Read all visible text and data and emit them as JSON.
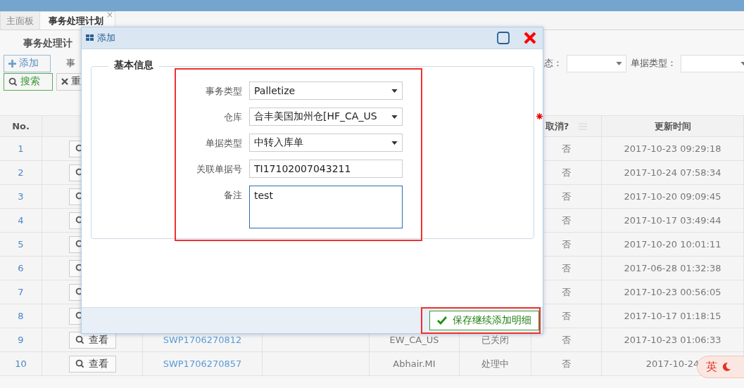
{
  "tabs": [
    {
      "label": "主面板",
      "selected": false
    },
    {
      "label": "事务处理计划",
      "selected": true,
      "close": "×"
    }
  ],
  "search_panel": {
    "title": "事务处理计",
    "add_button": "添加",
    "cut_label": "事",
    "search_button": "搜索",
    "reset_button": "重",
    "filters": [
      {
        "label": "态："
      },
      {
        "label": "单据类型："
      }
    ]
  },
  "table": {
    "header": {
      "no": "No.",
      "cancelled": "取消?",
      "updated": "更新时间"
    },
    "rows": [
      {
        "no": "1",
        "actions": [
          {
            "kind": "view"
          }
        ],
        "cancelled": "否",
        "updated": "2017-10-23 09:29:18"
      },
      {
        "no": "2",
        "actions": [
          {
            "kind": "view"
          }
        ],
        "cancelled": "否",
        "updated": "2017-10-24 07:58:34"
      },
      {
        "no": "3",
        "actions": [
          {
            "kind": "view"
          }
        ],
        "cancelled": "否",
        "updated": "2017-10-20 09:09:45"
      },
      {
        "no": "4",
        "actions": [
          {
            "kind": "view"
          }
        ],
        "cancelled": "否",
        "updated": "2017-10-17 03:49:44"
      },
      {
        "no": "5",
        "actions": [
          {
            "kind": "view"
          }
        ],
        "cancelled": "否",
        "updated": "2017-10-20 10:01:11"
      },
      {
        "no": "6",
        "actions": [
          {
            "kind": "view"
          }
        ],
        "cancelled": "否",
        "updated": "2017-06-28 01:32:38"
      },
      {
        "no": "7",
        "actions": [
          {
            "kind": "view"
          }
        ],
        "cancelled": "否",
        "updated": "2017-10-23 00:56:05"
      },
      {
        "no": "8",
        "actions": [
          {
            "kind": "view"
          }
        ],
        "cancelled": "否",
        "updated": "2017-10-17 01:18:15"
      },
      {
        "no": "9",
        "actions": [
          {
            "kind": "view",
            "label": "查看"
          }
        ],
        "order_no": "SWP1706270812",
        "warehouse": "EW_CA_US",
        "status": "已关闭",
        "cancelled": "否",
        "updated": "2017-10-23 01:06:33"
      },
      {
        "no": "10",
        "actions": [
          {
            "kind": "view",
            "label": "查看"
          }
        ],
        "order_no": "SWP1706270857",
        "warehouse": "Abhair.MI",
        "status": "处理中",
        "cancelled": "否",
        "updated": "2017-10-24"
      }
    ]
  },
  "dialog": {
    "title": "添加",
    "section": "基本信息",
    "fields": [
      {
        "kind": "select",
        "label": "事务类型",
        "value": "Palletize",
        "required": false
      },
      {
        "kind": "select",
        "label": "仓库",
        "value": "合丰美国加州仓[HF_CA_US",
        "required": true
      },
      {
        "kind": "select",
        "label": "单据类型",
        "value": "中转入库单",
        "required": false
      },
      {
        "kind": "text",
        "label": "关联单据号",
        "value": "TI17102007043211",
        "required": false
      },
      {
        "kind": "textarea",
        "label": "备注",
        "value": "test",
        "required": false,
        "focused": true
      }
    ],
    "save_button": "保存继续添加明细"
  },
  "ime_badge": {
    "label": "英"
  }
}
